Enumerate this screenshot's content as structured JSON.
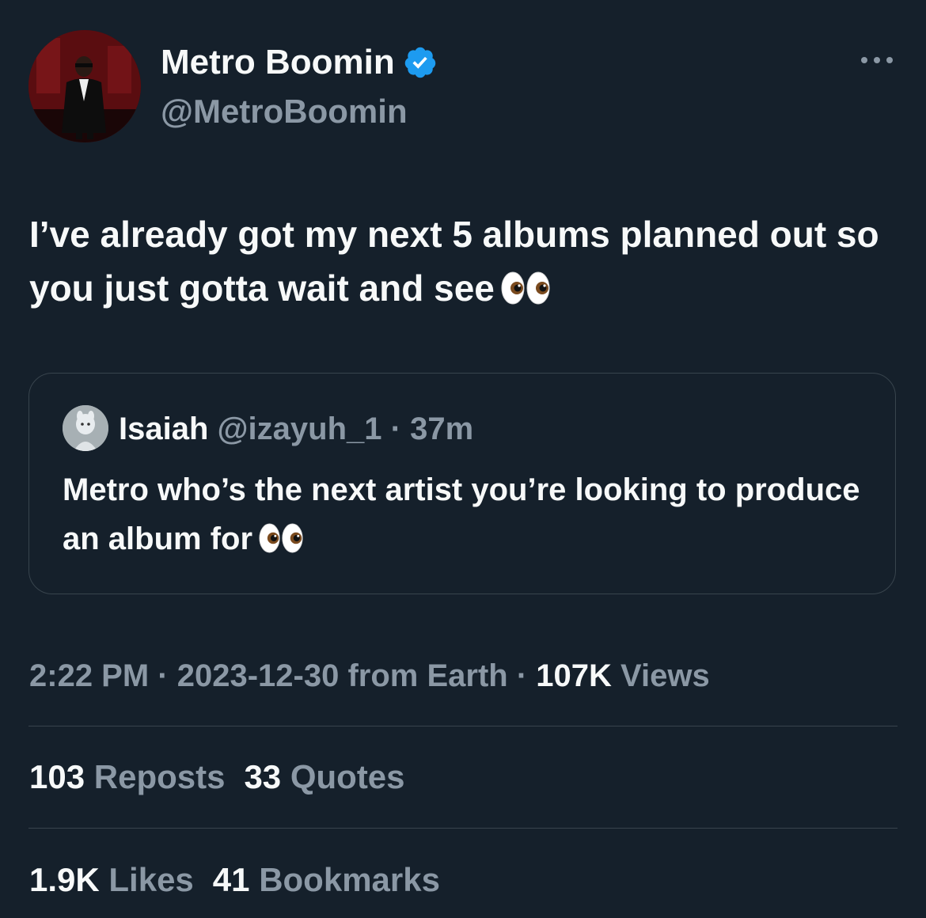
{
  "author": {
    "name": "Metro Boomin",
    "handle": "@MetroBoomin",
    "verified_color": "#1d9bf0"
  },
  "tweet": {
    "text": "I’ve already got my next 5 albums planned out so you just gotta wait and see",
    "emoji": "eyes-emoji"
  },
  "quote": {
    "name": "Isaiah",
    "handle": "@izayuh_1",
    "separator": "·",
    "time": "37m",
    "text": "Metro who’s the next artist you’re looking to produce an album for",
    "emoji": "eyes-emoji"
  },
  "meta": {
    "time": "2:22 PM",
    "sep1": "·",
    "date": "2023-12-30 from Earth",
    "sep2": "·",
    "views_count": "107K",
    "views_label": "Views"
  },
  "stats": {
    "reposts_count": "103",
    "reposts_label": "Reposts",
    "quotes_count": "33",
    "quotes_label": "Quotes",
    "likes_count": "1.9K",
    "likes_label": "Likes",
    "bookmarks_count": "41",
    "bookmarks_label": "Bookmarks"
  },
  "colors": {
    "background": "#15202b",
    "primary_text": "#f7f9f9",
    "secondary_text": "#8b98a5",
    "border": "#38444d",
    "accent": "#1d9bf0"
  }
}
